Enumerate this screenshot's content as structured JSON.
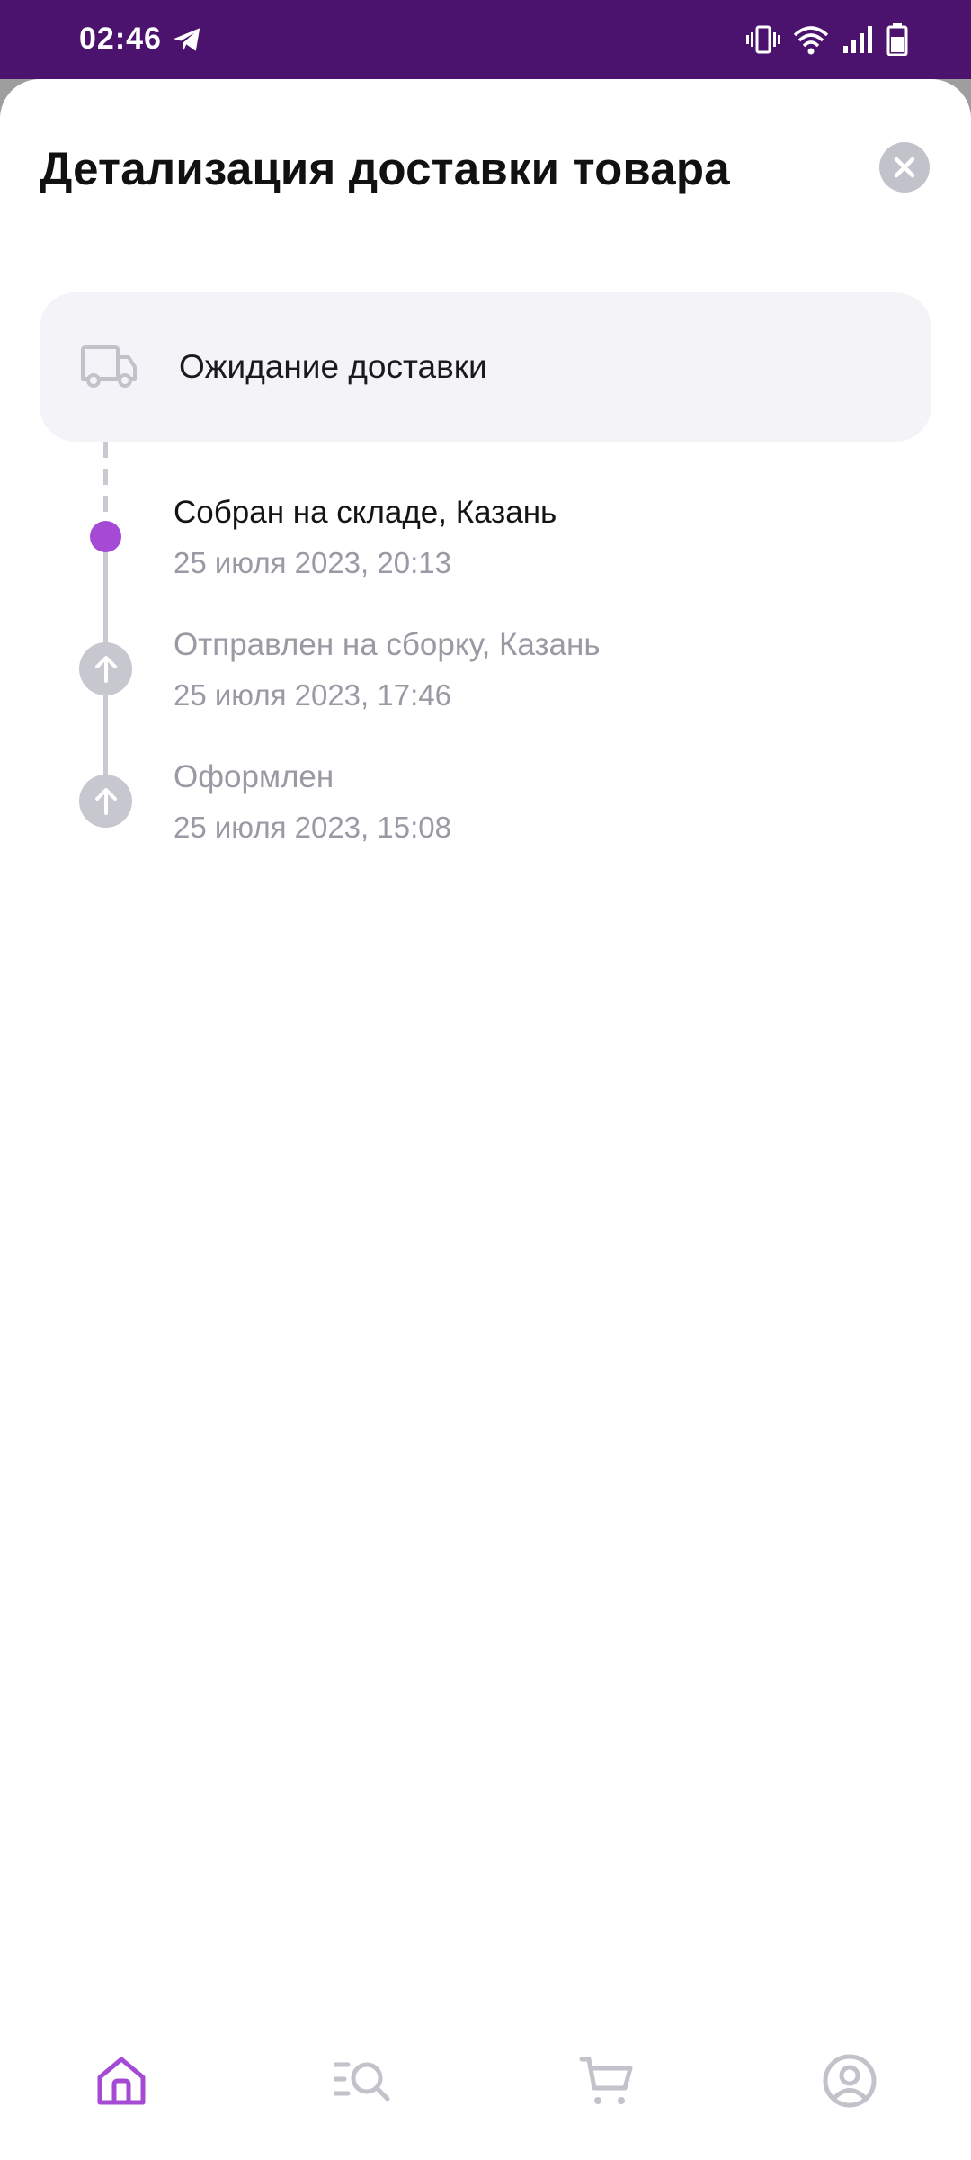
{
  "status_bar": {
    "time": "02:46",
    "icons": [
      "telegram-icon",
      "vibrate-icon",
      "wifi-icon",
      "signal-icon",
      "battery-icon"
    ]
  },
  "sheet": {
    "title": "Детализация доставки товара",
    "current_status": "Ожидание доставки",
    "events": [
      {
        "title": "Собран на складе, Казань",
        "date": "25 июля 2023, 20:13",
        "state": "active"
      },
      {
        "title": "Отправлен на сборку, Казань",
        "date": "25 июля 2023, 17:46",
        "state": "past"
      },
      {
        "title": "Оформлен",
        "date": "25 июля 2023, 15:08",
        "state": "past"
      }
    ]
  },
  "bottom_nav": {
    "items": [
      {
        "icon": "home-icon",
        "active": true
      },
      {
        "icon": "catalog-search-icon",
        "active": false
      },
      {
        "icon": "cart-icon",
        "active": false
      },
      {
        "icon": "profile-icon",
        "active": false
      }
    ]
  },
  "colors": {
    "status_bar": "#4b136e",
    "accent": "#a44ad5",
    "muted_text": "#9a9aa4",
    "timeline": "#c9c9d1",
    "card_bg": "#f4f4f8"
  }
}
